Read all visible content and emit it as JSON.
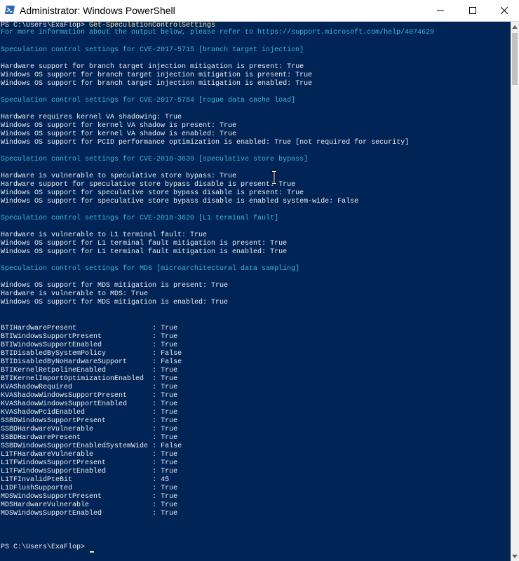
{
  "window": {
    "title": "Administrator: Windows PowerShell",
    "controls": [
      "minimize-icon",
      "maximize-icon",
      "close-icon"
    ]
  },
  "console": {
    "prompt": "PS C:\\Users\\ExaFlop> ",
    "command": "Get-SpeculationControlSettings",
    "info_line": "For more information about the output below, please refer to https://support.microsoft.com/help/4074629",
    "sections": [
      {
        "header": "Speculation control settings for CVE-2017-5715 [branch target injection]",
        "lines": [
          "Hardware support for branch target injection mitigation is present: True",
          "Windows OS support for branch target injection mitigation is present: True",
          "Windows OS support for branch target injection mitigation is enabled: True"
        ]
      },
      {
        "header": "Speculation control settings for CVE-2017-5754 [rogue data cache load]",
        "lines": [
          "Hardware requires kernel VA shadowing: True",
          "Windows OS support for kernel VA shadow is present: True",
          "Windows OS support for kernel VA shadow is enabled: True",
          "Windows OS support for PCID performance optimization is enabled: True [not required for security]"
        ]
      },
      {
        "header": "Speculation control settings for CVE-2018-3639 [speculative store bypass]",
        "lines": [
          "Hardware is vulnerable to speculative store bypass: True",
          "Hardware support for speculative store bypass disable is present: True",
          "Windows OS support for speculative store bypass disable is present: True",
          "Windows OS support for speculative store bypass disable is enabled system-wide: False"
        ]
      },
      {
        "header": "Speculation control settings for CVE-2018-3620 [L1 terminal fault]",
        "lines": [
          "Hardware is vulnerable to L1 terminal fault: True",
          "Windows OS support for L1 terminal fault mitigation is present: True",
          "Windows OS support for L1 terminal fault mitigation is enabled: True"
        ]
      },
      {
        "header": "Speculation control settings for MDS [microarchitectural data sampling]",
        "lines": [
          "Windows OS support for MDS mitigation is present: True",
          "Hardware is vulnerable to MDS: True",
          "Windows OS support for MDS mitigation is enabled: True"
        ]
      }
    ],
    "properties": [
      {
        "name": "BTIHardwarePresent",
        "value": "True"
      },
      {
        "name": "BTIWindowsSupportPresent",
        "value": "True"
      },
      {
        "name": "BTIWindowsSupportEnabled",
        "value": "True"
      },
      {
        "name": "BTIDisabledBySystemPolicy",
        "value": "False"
      },
      {
        "name": "BTIDisabledByNoHardwareSupport",
        "value": "False"
      },
      {
        "name": "BTIKernelRetpolineEnabled",
        "value": "True"
      },
      {
        "name": "BTIKernelImportOptimizationEnabled",
        "value": "True"
      },
      {
        "name": "KVAShadowRequired",
        "value": "True"
      },
      {
        "name": "KVAShadowWindowsSupportPresent",
        "value": "True"
      },
      {
        "name": "KVAShadowWindowsSupportEnabled",
        "value": "True"
      },
      {
        "name": "KVAShadowPcidEnabled",
        "value": "True"
      },
      {
        "name": "SSBDWindowsSupportPresent",
        "value": "True"
      },
      {
        "name": "SSBDHardwareVulnerable",
        "value": "True"
      },
      {
        "name": "SSBDHardwarePresent",
        "value": "True"
      },
      {
        "name": "SSBDWindowsSupportEnabledSystemWide",
        "value": "False"
      },
      {
        "name": "L1TFHardwareVulnerable",
        "value": "True"
      },
      {
        "name": "L1TFWindowsSupportPresent",
        "value": "True"
      },
      {
        "name": "L1TFWindowsSupportEnabled",
        "value": "True"
      },
      {
        "name": "L1TFInvalidPteBit",
        "value": "45"
      },
      {
        "name": "L1DFlushSupported",
        "value": "True"
      },
      {
        "name": "MDSWindowsSupportPresent",
        "value": "True"
      },
      {
        "name": "MDSHardwareVulnerable",
        "value": "True"
      },
      {
        "name": "MDSWindowsSupportEnabled",
        "value": "True"
      }
    ],
    "property_separator": ": "
  },
  "colors": {
    "background": "#012456",
    "text": "#eeedf0",
    "command": "#eeed9e",
    "section_header": "#3ab8d4"
  }
}
